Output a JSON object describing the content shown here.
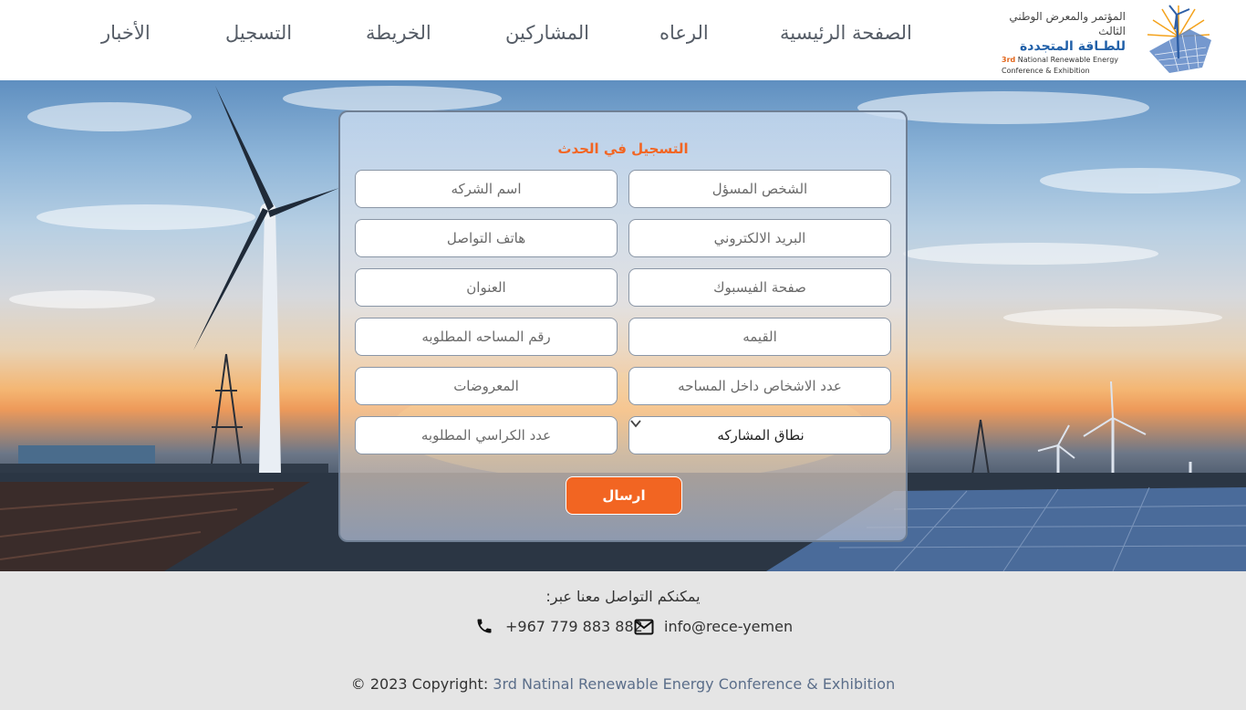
{
  "header": {
    "logo": {
      "line1": "المؤتمر والمعرض الوطني الثالث",
      "line2": "للطـاقة المتجددة",
      "en_num": "3rd",
      "en_line1": "National Renewable Energy",
      "en_line2": "Conference & Exhibition",
      "icon": "wind-solar-logo-icon"
    },
    "nav": [
      {
        "label": "الصفحة الرئيسية"
      },
      {
        "label": "الرعاه"
      },
      {
        "label": "المشاركين"
      },
      {
        "label": "الخريطة"
      },
      {
        "label": "التسجيل"
      },
      {
        "label": "الأخبار"
      }
    ]
  },
  "form": {
    "title": "التسجيل في الحدث",
    "fields": {
      "responsible_person": "الشخص المسؤل",
      "company_name": "اسم الشركه",
      "email": "البريد الالكتروني",
      "phone": "هاتف التواصل",
      "facebook": "صفحة الفيسبوك",
      "address": "العنوان",
      "value": "القيمه",
      "area_number": "رقم المساحه المطلوبه",
      "people_count": "عدد الاشخاص داخل المساحه",
      "exhibits": "المعروضات",
      "chairs_count": "عدد الكراسي المطلوبه"
    },
    "participation_scope": "نطاق المشاركه",
    "submit_label": "ارسال"
  },
  "footer": {
    "contact_title": "يمكنكم التواصل معنا عبر:",
    "phone": "+967 779 883 882",
    "email": "info@rece-yemen",
    "copyright_prefix": "© 2023 Copyright: ",
    "copyright_link": "3rd Natinal Renewable Energy Conference & Exhibition"
  },
  "colors": {
    "accent": "#f26522",
    "nav_text": "#555c66",
    "link": "#5b6e8a",
    "footer_bg": "#e5e5e5"
  }
}
